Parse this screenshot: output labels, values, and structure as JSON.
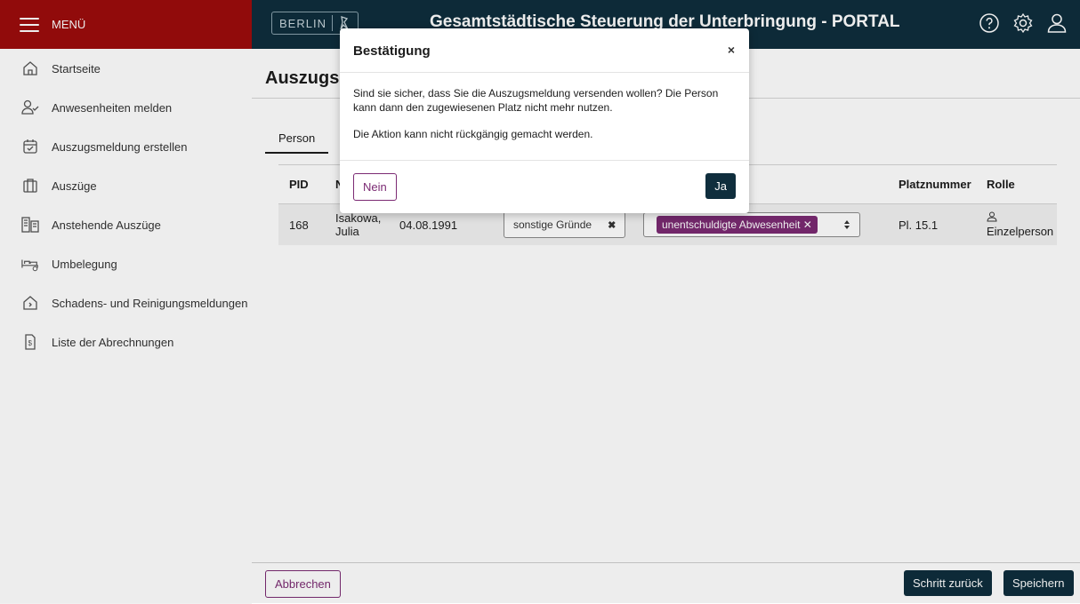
{
  "menu": {
    "label": "MENÜ"
  },
  "header": {
    "logo_text": "BERLIN",
    "title": "Gesamtstädtische Steuerung der Unterbringung - PORTAL"
  },
  "sidebar": {
    "items": [
      {
        "label": "Startseite",
        "icon": "home-icon"
      },
      {
        "label": "Anwesenheiten melden",
        "icon": "user-check-icon"
      },
      {
        "label": "Auszugsmeldung erstellen",
        "icon": "calendar-check-icon"
      },
      {
        "label": "Auszüge",
        "icon": "folder-icon"
      },
      {
        "label": "Anstehende Auszüge",
        "icon": "building-icon"
      },
      {
        "label": "Umbelegung",
        "icon": "bed-icon"
      },
      {
        "label": "Schadens- und Reinigungsmeldungen",
        "icon": "house-damage-icon"
      },
      {
        "label": "Liste der Abrechnungen",
        "icon": "invoice-icon"
      }
    ]
  },
  "main": {
    "title": "Auszugsı",
    "tab": "Person",
    "table": {
      "headers": [
        "PID",
        "Na",
        "",
        "",
        "",
        "Platznummer",
        "Rolle"
      ],
      "row": {
        "pid": "168",
        "name_line1": "Isakowa,",
        "name_line2": "Julia",
        "birthdate": "04.08.1991",
        "reason": "sonstige Gründe",
        "reason_clear": "✖",
        "tag": "unentschuldigte Abwesenheit ✕",
        "place": "Pl. 15.1",
        "role": "Einzelperson"
      }
    }
  },
  "footer": {
    "cancel": "Abbrechen",
    "back": "Schritt zurück",
    "save": "Speichern"
  },
  "modal": {
    "title": "Bestätigung",
    "close": "×",
    "text1": "Sind sie sicher, dass Sie die Auszugsmeldung versenden wollen? Die Person kann dann den zugewiesenen Platz nicht mehr nutzen.",
    "text2": "Die Aktion kann nicht rückgängig gemacht werden.",
    "no": "Nein",
    "yes": "Ja"
  },
  "colors": {
    "brand_red": "#9c0c0c",
    "dark_blue": "#0f2e3d",
    "accent_purple": "#7b2a73"
  }
}
